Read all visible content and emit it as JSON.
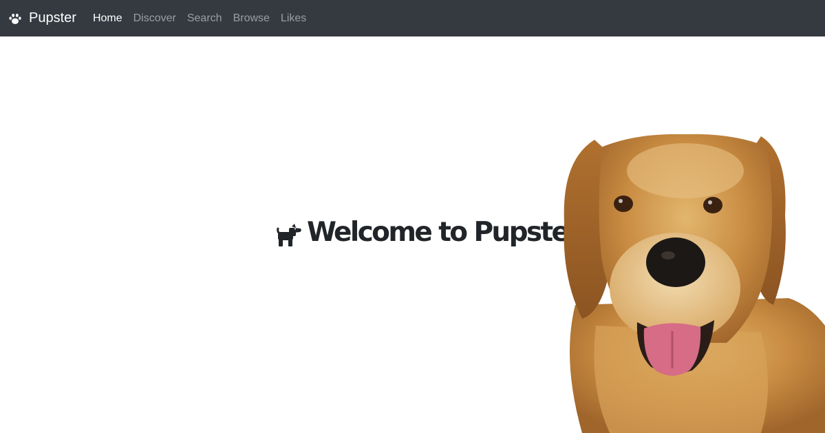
{
  "navbar": {
    "brand": "Pupster",
    "brand_icon": "paw-icon",
    "links": [
      {
        "label": "Home",
        "active": true
      },
      {
        "label": "Discover",
        "active": false
      },
      {
        "label": "Search",
        "active": false
      },
      {
        "label": "Browse",
        "active": false
      },
      {
        "label": "Likes",
        "active": false
      }
    ]
  },
  "hero": {
    "icon": "dog-icon",
    "title": "Welcome to Pupster!",
    "image": "golden-retriever-photo"
  },
  "colors": {
    "navbar_bg": "#343a40",
    "text_dark": "#212529",
    "nav_inactive": "rgba(255,255,255,0.5)"
  }
}
